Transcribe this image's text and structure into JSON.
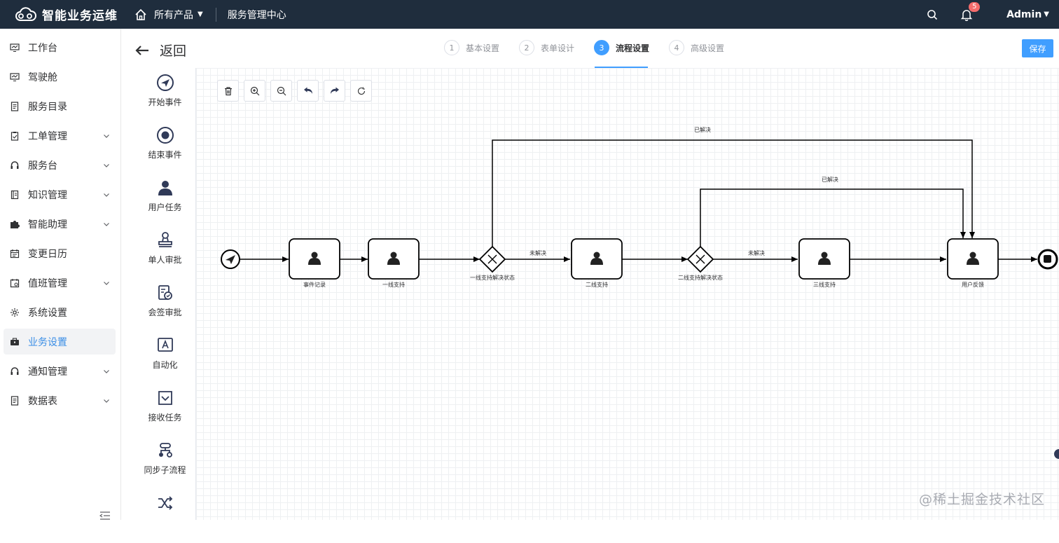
{
  "header": {
    "brand": "智能业务运维",
    "products_label": "所有产品",
    "center_label": "服务管理中心",
    "notification_count": "5",
    "user": "Admin"
  },
  "sidebar": {
    "items": [
      {
        "label": "工作台",
        "icon": "monitor-icon",
        "expandable": false
      },
      {
        "label": "驾驶舱",
        "icon": "monitor-icon",
        "expandable": false
      },
      {
        "label": "服务目录",
        "icon": "document-icon",
        "expandable": false
      },
      {
        "label": "工单管理",
        "icon": "clipboard-icon",
        "expandable": true
      },
      {
        "label": "服务台",
        "icon": "headset-icon",
        "expandable": true
      },
      {
        "label": "知识管理",
        "icon": "book-icon",
        "expandable": true
      },
      {
        "label": "智能助理",
        "icon": "puzzle-icon",
        "expandable": true
      },
      {
        "label": "变更日历",
        "icon": "calendar-icon",
        "expandable": false
      },
      {
        "label": "值班管理",
        "icon": "schedule-icon",
        "expandable": true
      },
      {
        "label": "系统设置",
        "icon": "gear-icon",
        "expandable": false
      },
      {
        "label": "业务设置",
        "icon": "toolbox-icon",
        "expandable": false,
        "active": true
      },
      {
        "label": "通知管理",
        "icon": "headset-icon",
        "expandable": true
      },
      {
        "label": "数据表",
        "icon": "document-icon",
        "expandable": true
      }
    ]
  },
  "page": {
    "back_label": "返回",
    "save_label": "保存",
    "steps": [
      {
        "num": "1",
        "label": "基本设置"
      },
      {
        "num": "2",
        "label": "表单设计"
      },
      {
        "num": "3",
        "label": "流程设置",
        "active": true
      },
      {
        "num": "4",
        "label": "高级设置"
      }
    ]
  },
  "palette": [
    {
      "label": "开始事件",
      "icon": "send-circle-icon"
    },
    {
      "label": "结束事件",
      "icon": "stop-circle-icon"
    },
    {
      "label": "用户任务",
      "icon": "user-icon"
    },
    {
      "label": "单人审批",
      "icon": "stamp-icon"
    },
    {
      "label": "会签审批",
      "icon": "multi-sign-icon"
    },
    {
      "label": "自动化",
      "icon": "auto-icon"
    },
    {
      "label": "接收任务",
      "icon": "receive-icon"
    },
    {
      "label": "同步子流程",
      "icon": "subprocess-icon"
    },
    {
      "label": "",
      "icon": "shuffle-icon"
    }
  ],
  "toolbar": [
    "delete-icon",
    "zoom-in-icon",
    "zoom-out-icon",
    "undo-icon",
    "redo-icon",
    "reset-icon"
  ],
  "flow": {
    "tasks": [
      "事件记录",
      "一线支持",
      "二线支持",
      "三线支持",
      "用户反馈"
    ],
    "gateways": [
      "一线支持解决状态",
      "二线支持解决状态"
    ],
    "edge_labels": {
      "resolved_1": "已解决",
      "resolved_2": "已解决",
      "unresolved_1": "未解决",
      "unresolved_2": "未解决"
    }
  },
  "watermark": "@稀土掘金技术社区",
  "colors": {
    "topbar": "#1f2d3d",
    "accent": "#409eff",
    "badge": "#f56c6c"
  }
}
